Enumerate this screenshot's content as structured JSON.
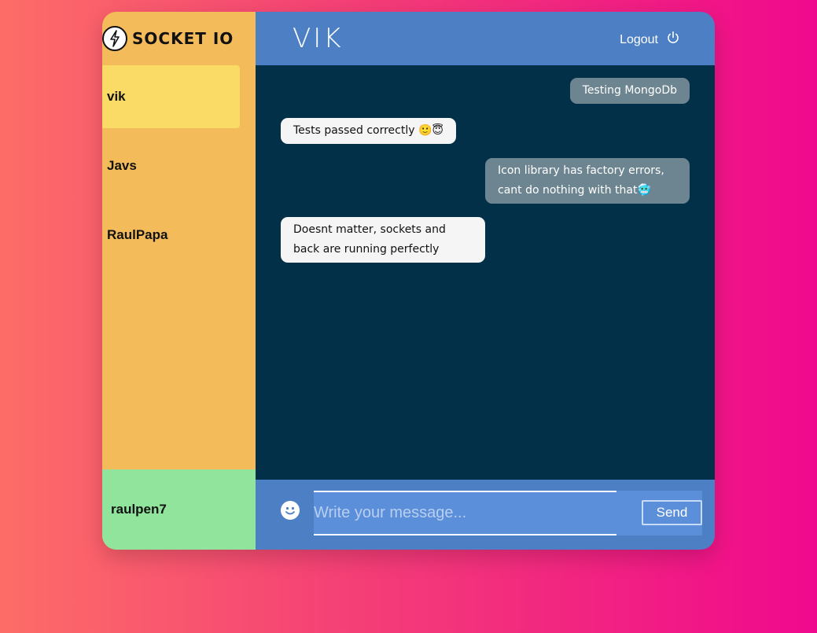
{
  "sidebar": {
    "brand": "SOCKET IO",
    "contacts": [
      {
        "name": "vik",
        "active": true
      },
      {
        "name": "Javs",
        "active": false
      },
      {
        "name": "RaulPapa",
        "active": false
      }
    ],
    "current_user": "raulpen7"
  },
  "header": {
    "title": "VIK",
    "logout_label": "Logout"
  },
  "messages": [
    {
      "text": "Testing MongoDb",
      "direction": "outgoing"
    },
    {
      "text": "Tests passed correctly 🙂😇",
      "direction": "incoming"
    },
    {
      "text": "Icon library has factory errors, cant do nothing with that🥶",
      "direction": "outgoing"
    },
    {
      "text": "Doesnt matter, sockets and back are running perfectly",
      "direction": "incoming"
    }
  ],
  "composer": {
    "placeholder": "Write your message...",
    "send_label": "Send"
  },
  "colors": {
    "sidebar": "#f4bb5a",
    "active_contact": "#fadb65",
    "current_user_bg": "#90e49b",
    "header": "#4c7fc4",
    "chat_bg": "#023049",
    "outgoing_bubble": "#6d8590",
    "incoming_bubble": "#f5f5f5"
  },
  "icons": {
    "brand": "lightning-bolt-icon",
    "logout": "power-icon",
    "emoji": "smiley-icon"
  }
}
